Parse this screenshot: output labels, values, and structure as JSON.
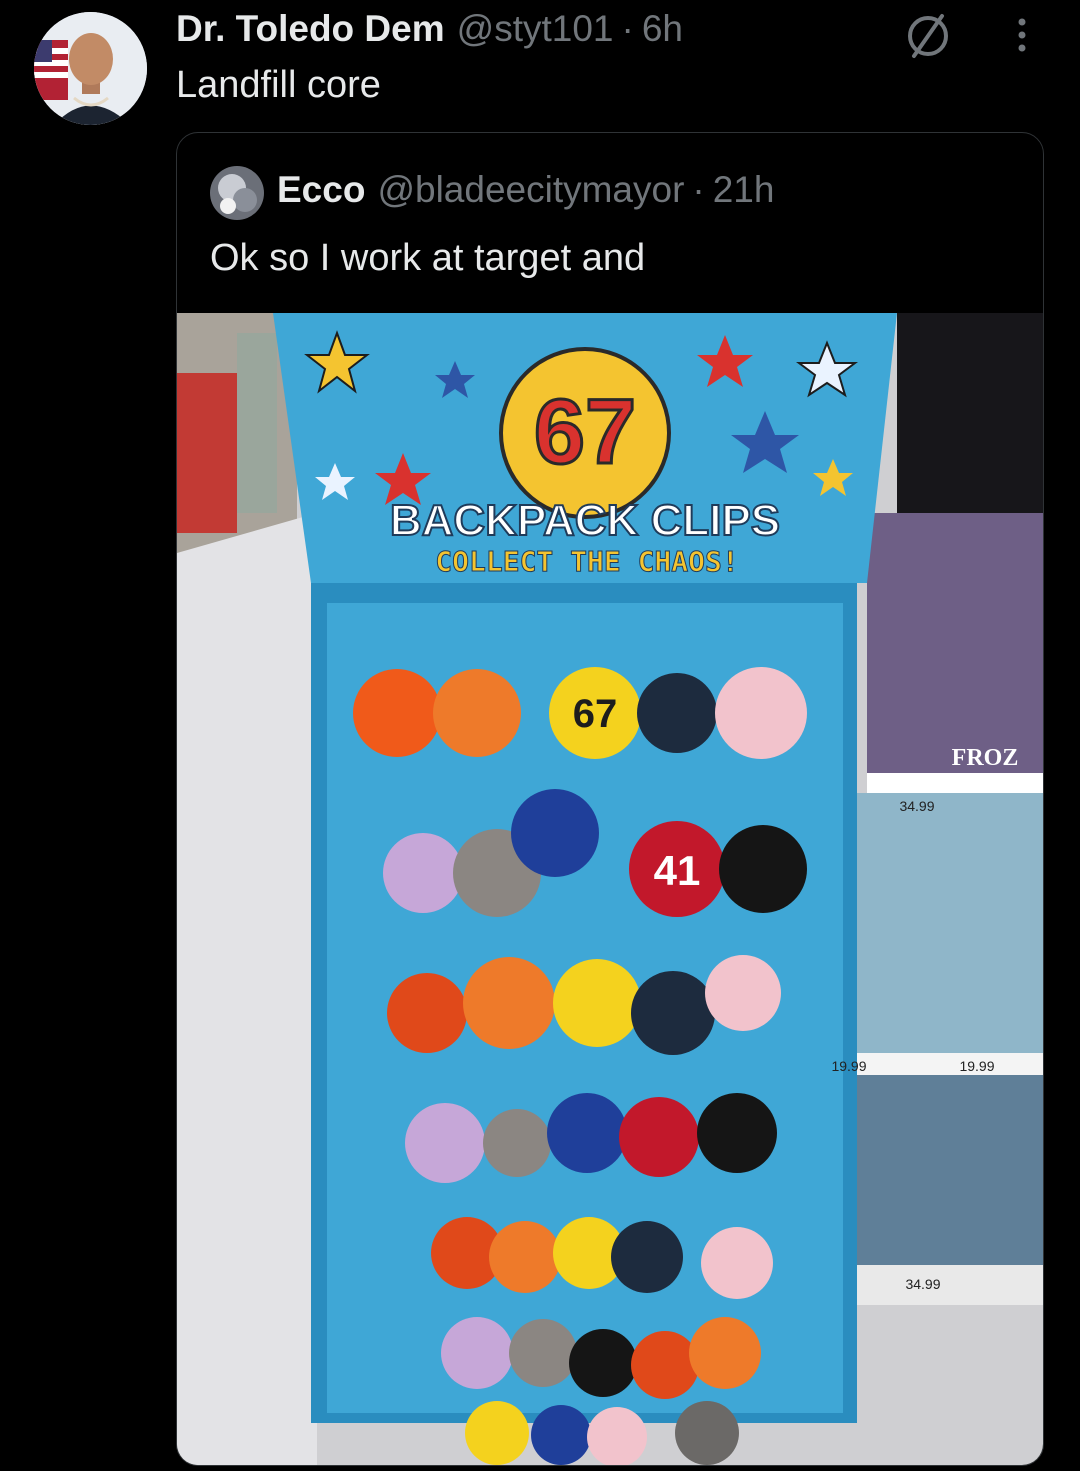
{
  "post": {
    "display_name": "Dr. Toledo Dem",
    "handle": "@styt101",
    "separator": "·",
    "timestamp": "6h",
    "text": "Landfill core"
  },
  "quote": {
    "display_name": "Ecco",
    "handle": "@bladeecitymayor",
    "separator": "·",
    "timestamp": "21h",
    "text": "Ok so I work at target and"
  },
  "photo": {
    "sign_number": "67",
    "sign_title": "BACKPACK CLIPS",
    "sign_subtitle": "COLLECT THE CHAOS!",
    "shelf_label": "FROZ",
    "price_tags": [
      "34.99",
      "19.99",
      "19.99",
      "34.99"
    ],
    "plush_numbers": [
      "67",
      "41"
    ]
  },
  "icons": {
    "post_action": "slash-circle-icon",
    "more": "more-vertical-icon"
  },
  "colors": {
    "background": "#000000",
    "text_primary": "#e7e9ea",
    "text_secondary": "#71767b",
    "border": "#2f3336",
    "sign_blue": "#3fa7d6",
    "sign_yellow": "#f4c430",
    "sign_red": "#d9322e"
  }
}
